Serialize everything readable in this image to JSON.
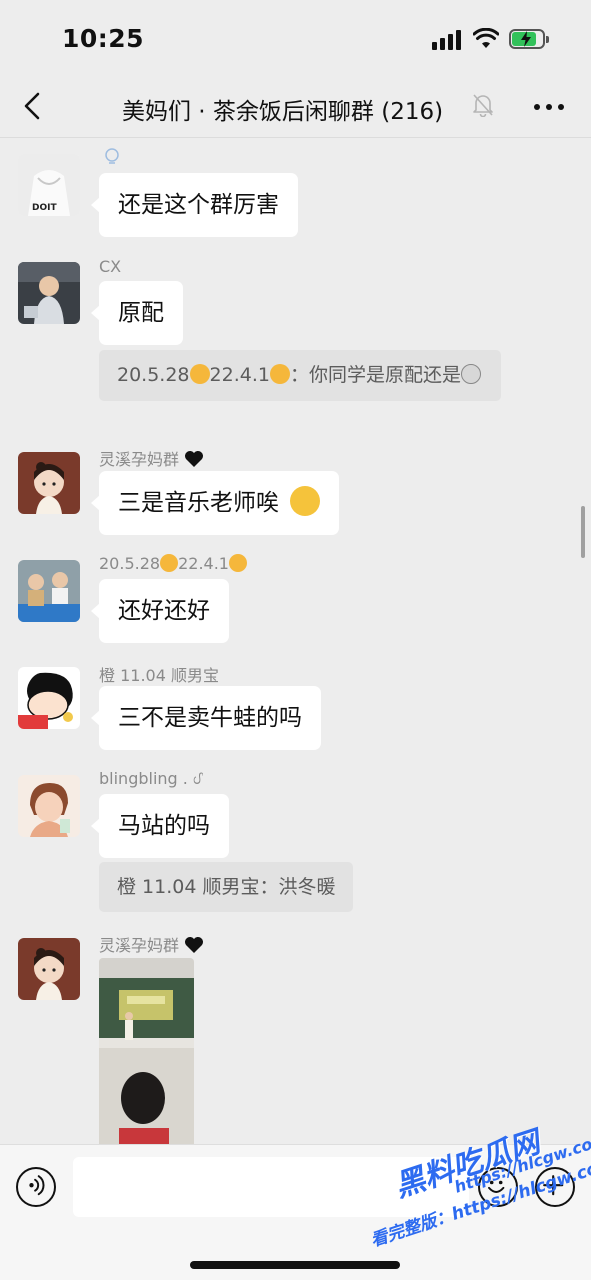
{
  "status_bar": {
    "time": "10:25"
  },
  "nav": {
    "title": "美妈们 · 茶余饭后闲聊群 (216)"
  },
  "messages": [
    {
      "sender": "",
      "text": "还是这个群厉害"
    },
    {
      "sender": "CX",
      "text": "原配",
      "quote": {
        "prefix": "20.5.28",
        "middle": "22.4.1",
        "text": "：你同学是原配还是"
      }
    },
    {
      "sender": "灵溪孕妈群",
      "text": "三是音乐老师唉"
    },
    {
      "sender_prefix": "20.5.28",
      "sender_middle": "22.4.1",
      "text": "还好还好"
    },
    {
      "sender": "橙 11.04 顺男宝",
      "text": "三不是卖牛蛙的吗"
    },
    {
      "sender": "blingbling . ᦔ",
      "text": "马站的吗",
      "quote": {
        "text": "橙 11.04 顺男宝：洪冬暖"
      }
    },
    {
      "sender": "灵溪孕妈群",
      "image": "photo"
    }
  ],
  "watermark": {
    "main": "黑料吃瓜网",
    "url": "https://hlcgw.co",
    "sub": "看完整版：https://hlcgw.co"
  },
  "colors": {
    "background": "#ededed",
    "bubble": "#ffffff",
    "quote": "#e2e2e2",
    "battery": "#32c15a",
    "watermark": "#2d6bf0"
  }
}
